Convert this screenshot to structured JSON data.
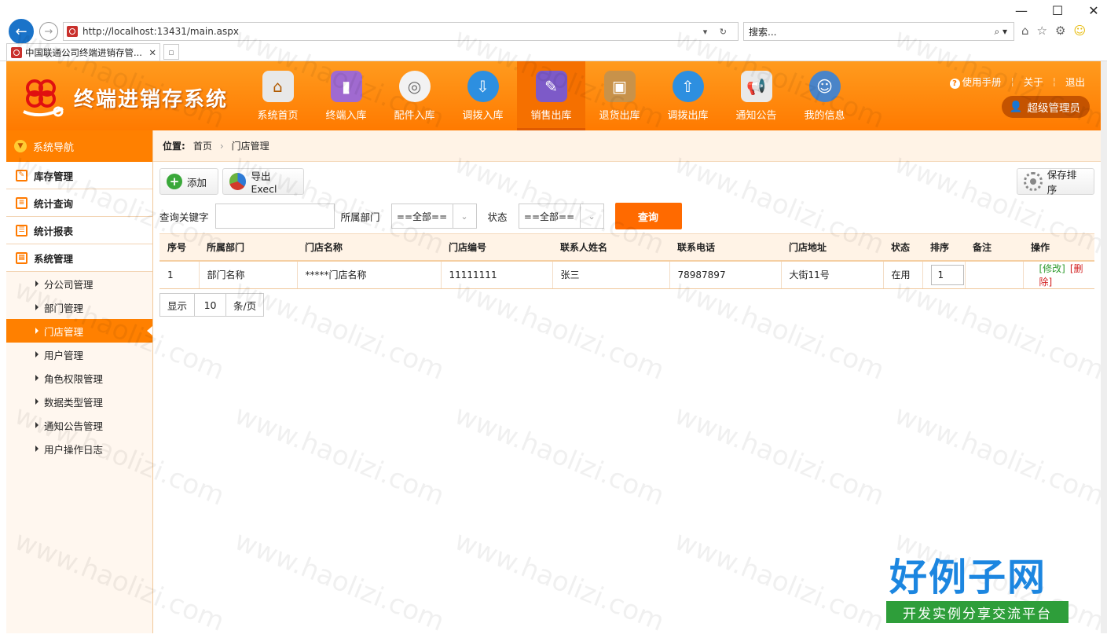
{
  "browser": {
    "url": "http://localhost:13431/main.aspx",
    "search_placeholder": "搜索...",
    "tab_title": "中国联通公司终端进销存管...",
    "window_controls": [
      "minimize-icon",
      "maximize-icon",
      "close-icon"
    ]
  },
  "app": {
    "title": "终端进销存系统",
    "nav": [
      {
        "label": "系统首页",
        "icon": "home-icon"
      },
      {
        "label": "终端入库",
        "icon": "phone-in-icon"
      },
      {
        "label": "配件入库",
        "icon": "accessory-icon"
      },
      {
        "label": "调拨入库",
        "icon": "transfer-in-icon"
      },
      {
        "label": "销售出库",
        "icon": "sales-out-icon"
      },
      {
        "label": "退货出库",
        "icon": "return-out-icon"
      },
      {
        "label": "调拨出库",
        "icon": "transfer-out-icon"
      },
      {
        "label": "通知公告",
        "icon": "megaphone-icon"
      },
      {
        "label": "我的信息",
        "icon": "user-info-icon"
      }
    ],
    "toplinks": {
      "manual": "使用手册",
      "about": "关于",
      "logout": "退出"
    },
    "user": "超级管理员"
  },
  "sidebar": {
    "header": "系统导航",
    "sections": [
      "库存管理",
      "统计查询",
      "统计报表",
      "系统管理"
    ],
    "items": [
      "分公司管理",
      "部门管理",
      "门店管理",
      "用户管理",
      "角色权限管理",
      "数据类型管理",
      "通知公告管理",
      "用户操作日志"
    ]
  },
  "breadcrumb": {
    "label": "位置:",
    "home": "首页",
    "current": "门店管理"
  },
  "toolbar": {
    "add": "添加",
    "export": "导出Execl",
    "save_sort": "保存排序"
  },
  "filters": {
    "keyword_label": "查询关键字",
    "dept_label": "所属部门",
    "dept_value": "==全部==",
    "status_label": "状态",
    "status_value": "==全部==",
    "query": "查询"
  },
  "table": {
    "headers": [
      "序号",
      "所属部门",
      "门店名称",
      "门店编号",
      "联系人姓名",
      "联系电话",
      "门店地址",
      "状态",
      "排序",
      "备注",
      "操作"
    ],
    "rows": [
      {
        "no": "1",
        "dept": "部门名称",
        "name": "*****门店名称",
        "code": "11111111",
        "contact": "张三",
        "phone": "78987897",
        "address": "大街11号",
        "status": "在用",
        "sort": "1",
        "remark": "",
        "edit": "[修改]",
        "delete": "[删除]"
      }
    ]
  },
  "pager": {
    "show": "显示",
    "size": "10",
    "unit": "条/页"
  },
  "watermark": "www.haolizi.com",
  "brand": {
    "big": "好例子网",
    "small": "开发实例分享交流平台"
  }
}
